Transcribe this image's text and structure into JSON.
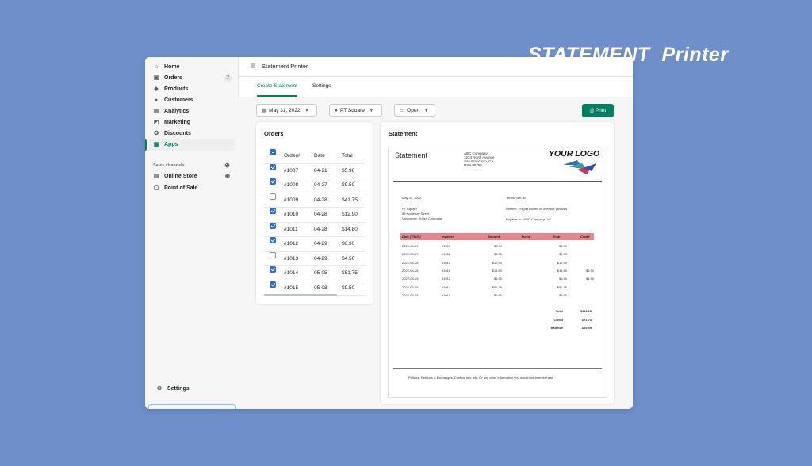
{
  "banner": {
    "word1": "STATEMENT",
    "word2": "Printer"
  },
  "sidebar": {
    "items": [
      {
        "label": "Home",
        "icon": "home-icon"
      },
      {
        "label": "Orders",
        "icon": "orders-icon",
        "badge": "7"
      },
      {
        "label": "Products",
        "icon": "tag-icon"
      },
      {
        "label": "Customers",
        "icon": "person-icon"
      },
      {
        "label": "Analytics",
        "icon": "bar-chart-icon"
      },
      {
        "label": "Marketing",
        "icon": "megaphone-icon"
      },
      {
        "label": "Discounts",
        "icon": "discount-icon"
      },
      {
        "label": "Apps",
        "icon": "apps-icon",
        "active": true
      }
    ],
    "sales_channels_label": "Sales channels",
    "channels": [
      {
        "label": "Online Store",
        "icon": "store-icon"
      },
      {
        "label": "Point of Sale",
        "icon": "pos-icon"
      }
    ],
    "settings_label": "Settings"
  },
  "topbar": {
    "app_name": "Statement Printer"
  },
  "tabs": [
    {
      "label": "Create Statement",
      "active": true
    },
    {
      "label": "Settings",
      "active": false
    }
  ],
  "filters": {
    "date": "May 31, 2022",
    "customer": "PT Square",
    "status": "Open"
  },
  "print_label": "Print",
  "orders": {
    "title": "Orders",
    "columns": [
      "Order#",
      "Date",
      "Total"
    ],
    "rows": [
      {
        "order": "#1007",
        "date": "04-21",
        "total": "$5.90",
        "checked": true
      },
      {
        "order": "#1008",
        "date": "04-27",
        "total": "$9.50",
        "checked": true
      },
      {
        "order": "#1009",
        "date": "04-28",
        "total": "$41.75",
        "checked": false
      },
      {
        "order": "#1010",
        "date": "04-28",
        "total": "$12.90",
        "checked": true
      },
      {
        "order": "#1011",
        "date": "04-28",
        "total": "$14.80",
        "checked": true
      },
      {
        "order": "#1012",
        "date": "04-29",
        "total": "$6.90",
        "checked": true
      },
      {
        "order": "#1013",
        "date": "04-29",
        "total": "$4.50",
        "checked": false
      },
      {
        "order": "#1014",
        "date": "05-05",
        "total": "$51.75",
        "checked": true
      },
      {
        "order": "#1015",
        "date": "05-08",
        "total": "$9.50",
        "checked": true
      }
    ]
  },
  "statement": {
    "title": "Statement",
    "doc_title": "Statement",
    "company_lines": [
      "ABC Company",
      "1234 North Avenue",
      "San Francisco, CA",
      "USA 98765"
    ],
    "logo": "YOUR LOGO",
    "date": "May 31, 2022",
    "terms": "Terms: Net 30",
    "interest": "Interest: 2% per month on overdue invoices",
    "payable": "Payable to: \"ABC Company Ltd\"",
    "customer_lines": [
      "PT Square",
      "88 Kootenay Street",
      "Vancouver, British Columbia"
    ],
    "columns": [
      "Date (Y/M/D)",
      "Invoice#",
      "Amount",
      "Taxes",
      "Total",
      "Credit"
    ],
    "rows": [
      {
        "date": "2022-04-21",
        "invoice": "#1007",
        "amount": "$5.90",
        "taxes": "",
        "total": "$5.90",
        "credit": ""
      },
      {
        "date": "2022-04-27",
        "invoice": "#1008",
        "amount": "$9.50",
        "taxes": "",
        "total": "$9.50",
        "credit": ""
      },
      {
        "date": "2022-04-28",
        "invoice": "#1010",
        "amount": "$12.90",
        "taxes": "",
        "total": "$12.90",
        "credit": ""
      },
      {
        "date": "2022-04-28",
        "invoice": "#1011",
        "amount": "$14.80",
        "taxes": "",
        "total": "$14.80",
        "credit": "$9.90"
      },
      {
        "date": "2022-04-29",
        "invoice": "#1012",
        "amount": "$6.90",
        "taxes": "",
        "total": "$6.90",
        "credit": "$6.90"
      },
      {
        "date": "2022-05-05",
        "invoice": "#1014",
        "amount": "$51.75",
        "taxes": "",
        "total": "$51.75",
        "credit": ""
      },
      {
        "date": "2022-05-08",
        "invoice": "#1015",
        "amount": "$9.50",
        "taxes": "",
        "total": "$9.50",
        "credit": ""
      }
    ],
    "summary": [
      {
        "label": "Total",
        "value": "$111.25"
      },
      {
        "label": "Credit",
        "value": "$21.70"
      },
      {
        "label": "Balance",
        "value": "$89.55"
      }
    ],
    "footer": "Policies, Refunds & Exchanges, Contact Info, etc.  Or any other information you would like to enter here."
  },
  "colors": {
    "accent": "#008060",
    "checkbox": "#2c6ecb",
    "table_header": "#e4888c",
    "background": "#6f8fca"
  }
}
